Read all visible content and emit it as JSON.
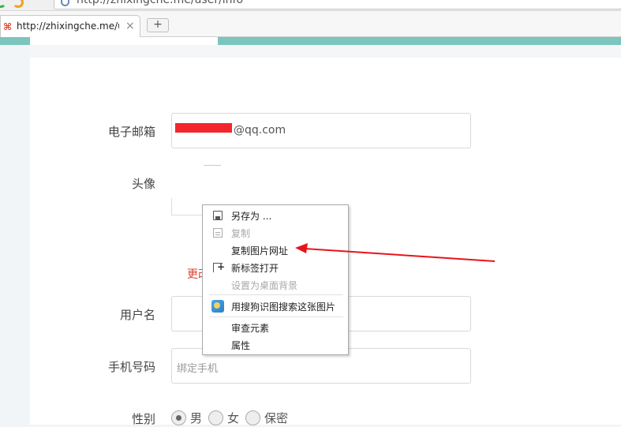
{
  "browser": {
    "url": "http://zhixingche.me/user/info",
    "tab_title": "http://zhixingche.me/u",
    "tab_close_glyph": "×",
    "new_tab_glyph": "+"
  },
  "form": {
    "email": {
      "label": "电子邮箱",
      "value_suffix": "@qq.com"
    },
    "avatar": {
      "label": "头像",
      "change_link": "更改"
    },
    "username": {
      "label": "用户名",
      "value": ""
    },
    "phone": {
      "label": "手机号码",
      "placeholder": "绑定手机"
    },
    "gender": {
      "label": "性别",
      "options": [
        "男",
        "女",
        "保密"
      ],
      "selected": "男"
    }
  },
  "context_menu": {
    "items": [
      {
        "label": "另存为 ...",
        "icon": "save-icon",
        "disabled": false
      },
      {
        "label": "复制",
        "icon": "copy-icon",
        "disabled": true
      },
      {
        "label": "复制图片网址",
        "icon": "",
        "disabled": false
      },
      {
        "label": "新标签打开",
        "icon": "new-tab-icon",
        "disabled": false
      },
      {
        "label": "设置为桌面背景",
        "icon": "",
        "disabled": true
      },
      {
        "label": "用搜狗识图搜索这张图片",
        "icon": "sogou-image-search-icon",
        "disabled": false
      },
      {
        "label": "审查元素",
        "icon": "",
        "disabled": false
      },
      {
        "label": "属性",
        "icon": "",
        "disabled": false
      }
    ]
  },
  "colors": {
    "accent_teal": "#7cc5bd",
    "redaction": "#f2262c",
    "arrow": "#e8141c",
    "link_red": "#d9412e"
  }
}
